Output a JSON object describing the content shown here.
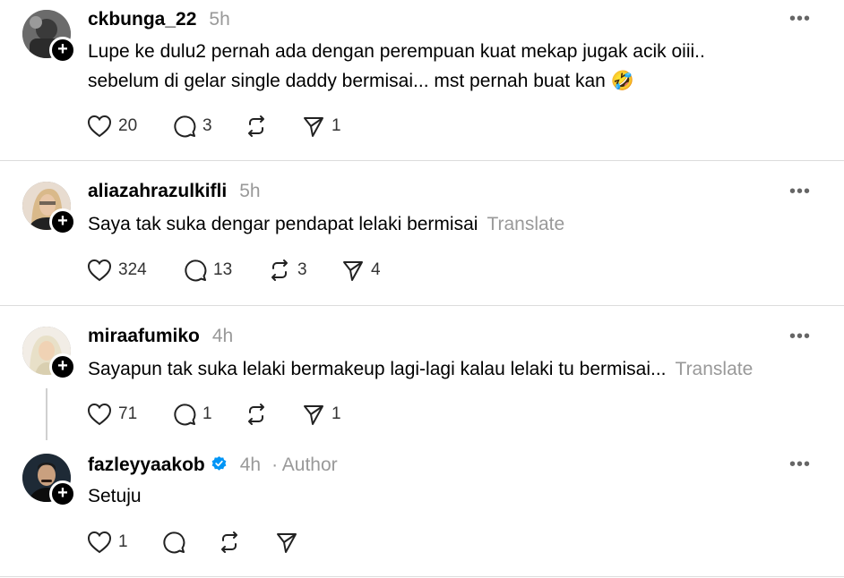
{
  "posts": [
    {
      "username": "ckbunga_22",
      "time": "5h",
      "text_lines": [
        "Lupe ke dulu2 pernah ada dengan perempuan kuat mekap jugak acik oiii..",
        "sebelum di gelar single daddy bermisai... mst pernah buat kan 🤣"
      ],
      "likes": "20",
      "replies": "3",
      "reposts": "",
      "shares": "1"
    },
    {
      "username": "aliazahrazulkifli",
      "time": "5h",
      "text_lines": [
        "Saya tak suka dengar pendapat lelaki bermisai"
      ],
      "translate": "Translate",
      "likes": "324",
      "replies": "13",
      "reposts": "3",
      "shares": "4"
    },
    {
      "username": "miraafumiko",
      "time": "4h",
      "text_lines": [
        "Sayapun tak suka lelaki bermakeup lagi-lagi kalau lelaki tu bermisai..."
      ],
      "translate": "Translate",
      "likes": "71",
      "replies": "1",
      "reposts": "",
      "shares": "1"
    },
    {
      "username": "fazleyyaakob",
      "verified": true,
      "time": "4h",
      "author_label": "· Author",
      "text_lines": [
        "Setuju"
      ],
      "likes": "1",
      "replies": "",
      "reposts": "",
      "shares": ""
    }
  ],
  "icons": {
    "more": "more-dots-icon",
    "like": "heart-icon",
    "reply": "comment-icon",
    "repost": "repost-icon",
    "share": "send-icon",
    "follow": "plus-icon",
    "verified": "verified-badge-icon"
  },
  "colors": {
    "verified": "#0095f6",
    "muted": "#999999"
  }
}
